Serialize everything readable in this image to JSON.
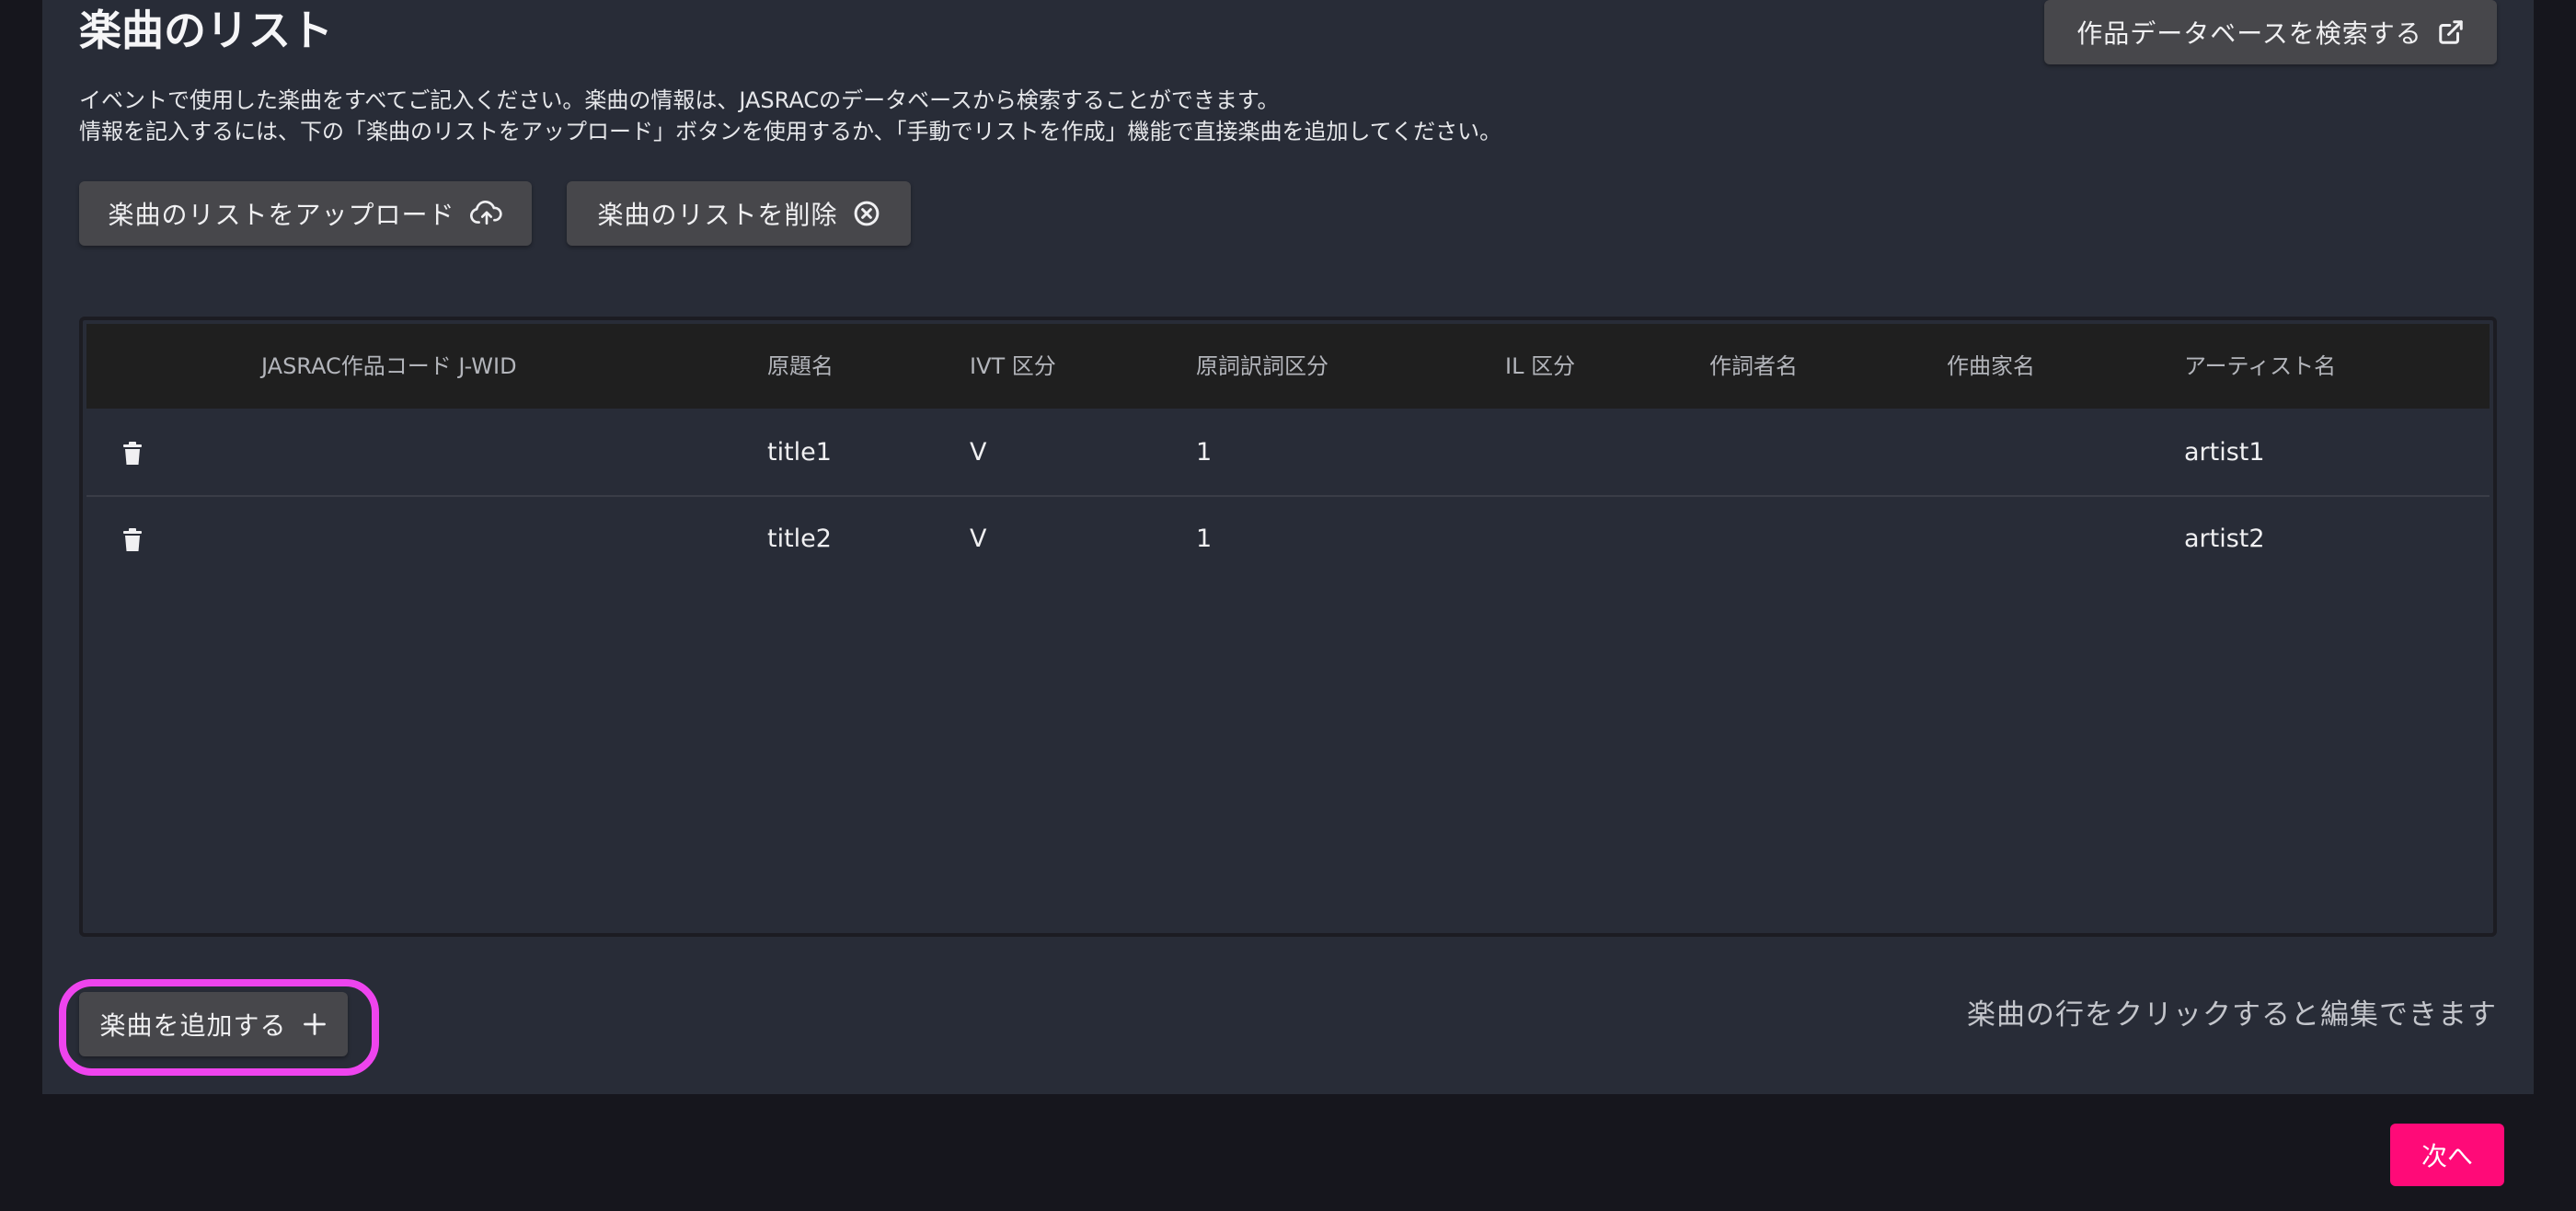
{
  "section": {
    "title": "楽曲のリスト",
    "description_line1": "イベントで使用した楽曲をすべてご記入ください。楽曲の情報は、JASRACのデータベースから検索することができます。",
    "description_line2": "情報を記入するには、下の「楽曲のリストをアップロード」ボタンを使用するか、「手動でリストを作成」機能で直接楽曲を追加してください。"
  },
  "buttons": {
    "search_db": "作品データベースを検索する",
    "upload_list": "楽曲のリストをアップロード",
    "delete_list": "楽曲のリストを削除",
    "add_song": "楽曲を追加する",
    "next": "次へ"
  },
  "table": {
    "columns": [
      "JASRAC作品コード J-WID",
      "原題名",
      "IVT 区分",
      "原詞訳詞区分",
      "IL 区分",
      "作詞者名",
      "作曲家名",
      "アーティスト名"
    ],
    "rows": [
      {
        "jwid": "",
        "title": "title1",
        "ivt": "V",
        "lyrics_type": "1",
        "il": "",
        "lyricist": "",
        "composer": "",
        "artist": "artist1"
      },
      {
        "jwid": "",
        "title": "title2",
        "ivt": "V",
        "lyrics_type": "1",
        "il": "",
        "lyricist": "",
        "composer": "",
        "artist": "artist2"
      }
    ]
  },
  "hint": "楽曲の行をクリックすると編集できます",
  "icons": {
    "search_db": "external-link-icon",
    "upload_list": "cloud-upload-icon",
    "delete_list": "circle-x-icon",
    "add_song": "plus-icon",
    "row_delete": "trash-icon"
  },
  "colors": {
    "panel_bg": "#282c37",
    "page_bg": "#16161d",
    "button_bg": "#47474b",
    "table_header_bg": "#1f1f1f",
    "next_button": "#ff0a78",
    "highlight": "#ee44ee"
  }
}
